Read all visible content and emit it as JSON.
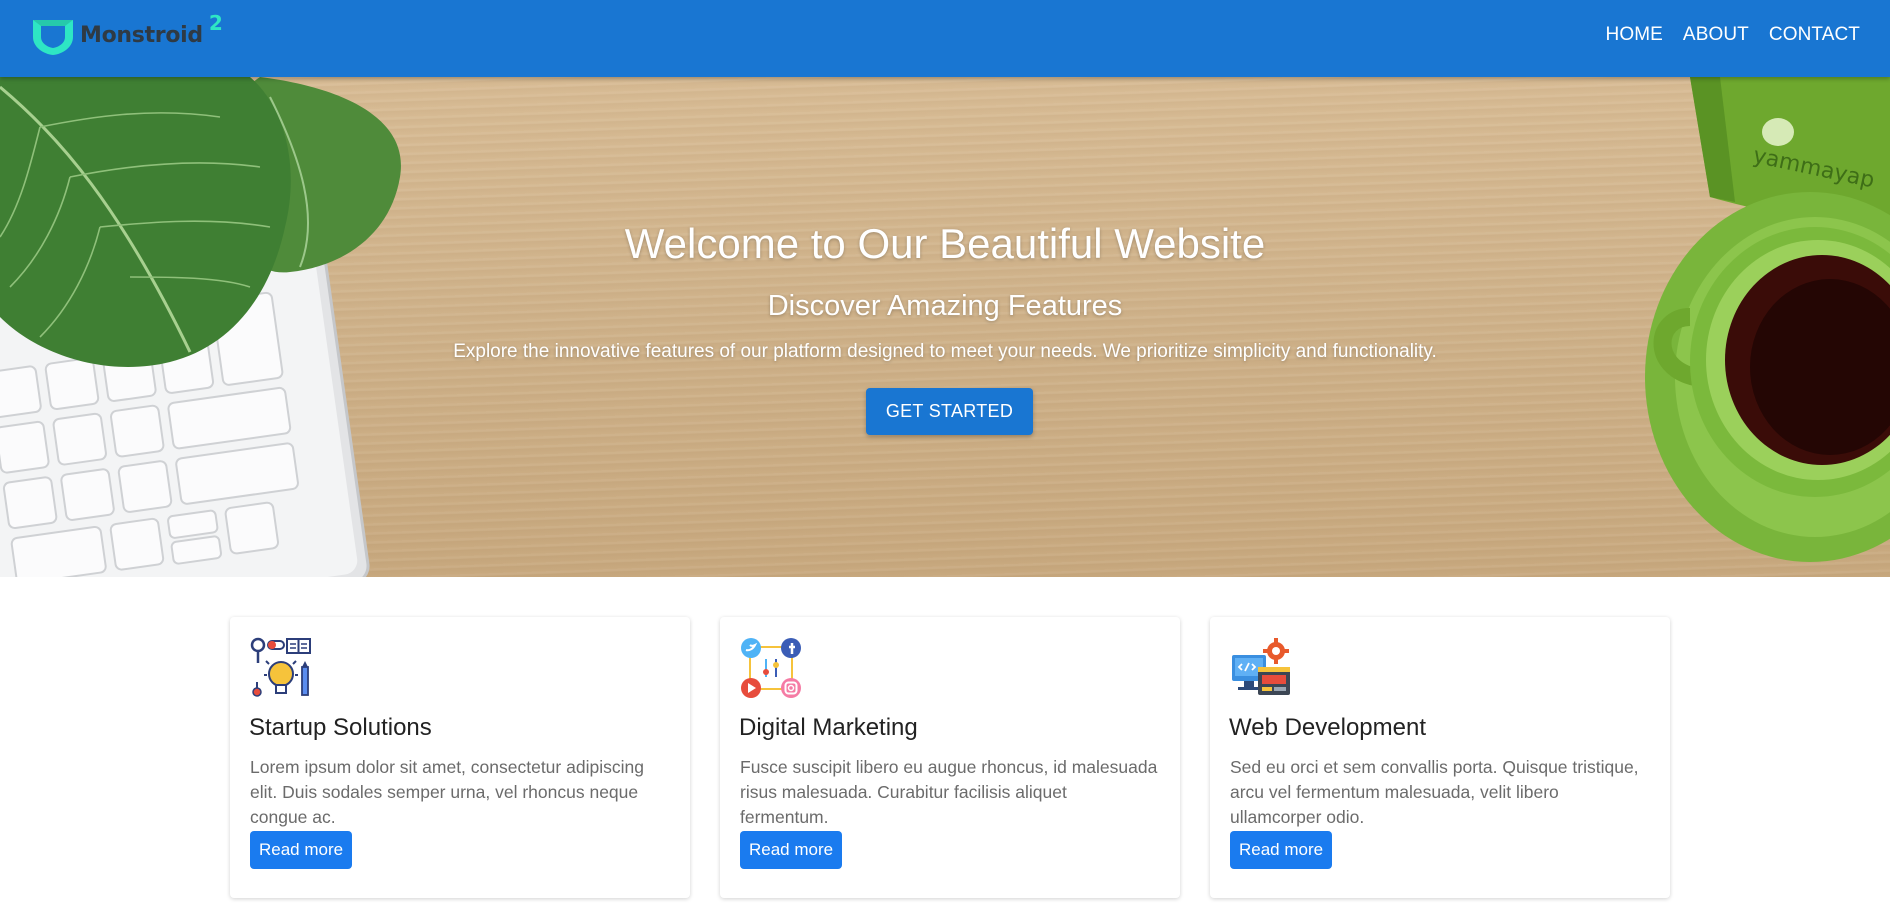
{
  "brand": {
    "name": "Monstroid",
    "superscript": "2"
  },
  "nav": {
    "items": [
      {
        "label": "HOME"
      },
      {
        "label": "ABOUT"
      },
      {
        "label": "CONTACT"
      }
    ]
  },
  "hero": {
    "title": "Welcome to Our Beautiful Website",
    "subtitle": "Discover Amazing Features",
    "description": "Explore the innovative features of our platform designed to meet your needs. We prioritize simplicity and functionality.",
    "cta_label": "GET STARTED",
    "mug_brand": "yammayap"
  },
  "cards": [
    {
      "icon": "startup-icon",
      "title": "Startup Solutions",
      "text": "Lorem ipsum dolor sit amet, consectetur adipiscing elit. Duis sodales semper urna, vel rhoncus neque congue ac.",
      "button_label": "Read more"
    },
    {
      "icon": "social-media-icon",
      "title": "Digital Marketing",
      "text": "Fusce suscipit libero eu augue rhoncus, id malesuada risus malesuada. Curabitur facilisis aliquet fermentum.",
      "button_label": "Read more"
    },
    {
      "icon": "web-development-icon",
      "title": "Web Development",
      "text": "Sed eu orci et sem convallis porta. Quisque tristique, arcu vel fermentum malesuada, velit libero ullamcorper odio.",
      "button_label": "Read more"
    }
  ],
  "colors": {
    "primary": "#1976d2",
    "button": "#1a7bef",
    "brand_accent": "#2ee6c4",
    "brand_text": "#2f3a44"
  }
}
